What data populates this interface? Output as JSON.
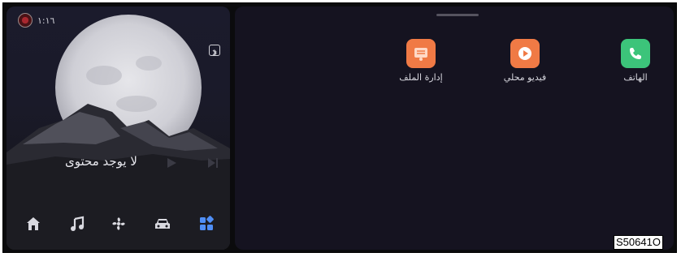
{
  "status_bar": {
    "time": "١:١٦",
    "brand_icon": "brand-logo-icon",
    "bluetooth_icon": "bluetooth-icon"
  },
  "media_card": {
    "no_content_text": "لا يوجد محتوى",
    "play_icon": "play-icon",
    "next_icon": "next-track-icon"
  },
  "dock": [
    {
      "name": "home",
      "icon": "home-icon"
    },
    {
      "name": "music",
      "icon": "music-note-icon"
    },
    {
      "name": "fan",
      "icon": "fan-icon"
    },
    {
      "name": "car",
      "icon": "car-icon"
    },
    {
      "name": "apps",
      "icon": "apps-grid-icon",
      "active": true
    }
  ],
  "apps": [
    {
      "label": "إدارة الملف",
      "icon": "file-manager-icon",
      "color": "#f07a45"
    },
    {
      "label": "فيديو محلي",
      "icon": "local-video-icon",
      "color": "#f07a45"
    },
    {
      "label": "الهاتف",
      "icon": "phone-icon",
      "color": "#3cc47a"
    }
  ],
  "figure_code": "S50641O",
  "colors": {
    "accent_blue": "#4f8ef5",
    "background": "#0b0b0d"
  }
}
